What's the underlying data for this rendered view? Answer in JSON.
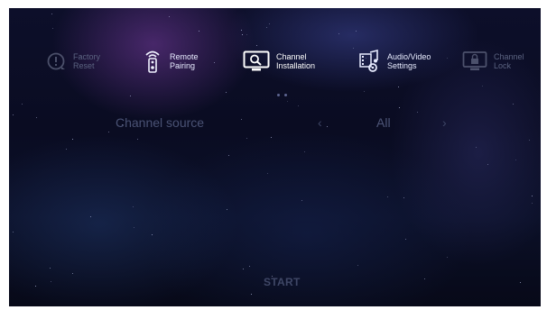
{
  "menu": {
    "items": [
      {
        "label": "Factory\nReset",
        "icon": "factory-reset-icon",
        "state": "dim"
      },
      {
        "label": "Remote\nPairing",
        "icon": "remote-icon",
        "state": "normal"
      },
      {
        "label": "Channel\nInstallation",
        "icon": "channel-installation-icon",
        "state": "active"
      },
      {
        "label": "Audio/Video\nSettings",
        "icon": "audio-video-icon",
        "state": "normal"
      },
      {
        "label": "Channel\nLock",
        "icon": "channel-lock-icon",
        "state": "dim"
      }
    ]
  },
  "pager": {
    "pages": 2,
    "current": 1
  },
  "channel_source": {
    "label": "Channel source",
    "value": "All",
    "prev_glyph": "‹",
    "next_glyph": "›"
  },
  "start_button": {
    "label": "START"
  },
  "colors": {
    "background": "#0b0d24",
    "text_active": "#ffffff",
    "text_dim": "#4a5274"
  }
}
